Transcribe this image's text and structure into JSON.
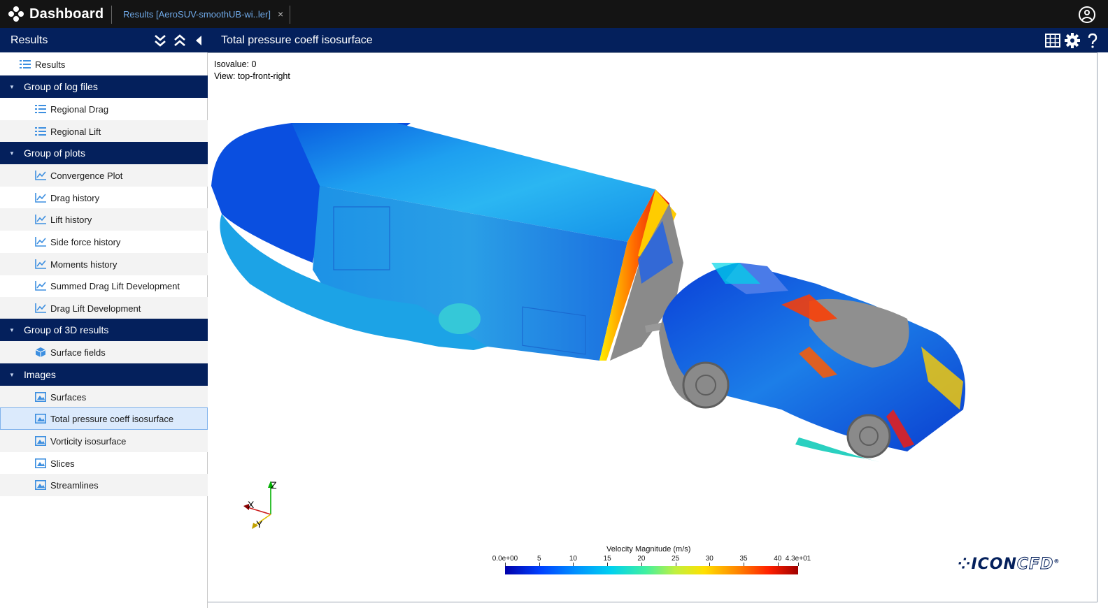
{
  "app": {
    "title": "Dashboard",
    "tab_label": "Results [AeroSUV-smoothUB-wi..ler]",
    "tab_close": "×"
  },
  "header": {
    "sidebar_title": "Results",
    "panel_title": "Total pressure coeff isosurface"
  },
  "sidebar": {
    "root": "Results",
    "groups": [
      {
        "label": "Group of log files",
        "items": [
          "Regional Drag",
          "Regional Lift"
        ]
      },
      {
        "label": "Group of plots",
        "items": [
          "Convergence Plot",
          "Drag history",
          "Lift history",
          "Side force history",
          "Moments history",
          "Summed Drag Lift Development",
          "Drag Lift Development"
        ]
      },
      {
        "label": "Group of 3D results",
        "items": [
          "Surface fields"
        ]
      },
      {
        "label": "Images",
        "items": [
          "Surfaces",
          "Total pressure coeff isosurface",
          "Vorticity isosurface",
          "Slices",
          "Streamlines"
        ]
      }
    ],
    "selected": "Total pressure coeff isosurface"
  },
  "viewer": {
    "isovalue": "Isovalue: 0",
    "view": "View: top-front-right",
    "axes": {
      "z": "Z",
      "x": "X",
      "y": "Y"
    },
    "colorbar": {
      "title": "Velocity Magnitude (m/s)",
      "ticks": [
        "0.0e+00",
        "5",
        "10",
        "15",
        "20",
        "25",
        "30",
        "35",
        "40",
        "4.3e+01"
      ],
      "min": 0,
      "max": 43
    },
    "logo": {
      "icon": "ICON",
      "cfd": "CFD",
      "mark": "®"
    }
  },
  "colors": {
    "topbar": "#141414",
    "navy": "#04205c",
    "accent": "#3d8fe0",
    "selected_row": "#dbeafc"
  }
}
